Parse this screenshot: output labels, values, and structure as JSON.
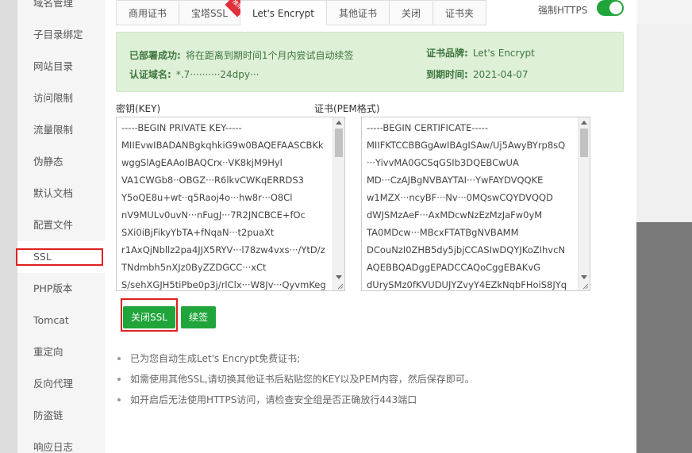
{
  "sidebar": {
    "items": [
      {
        "label": "域名管理"
      },
      {
        "label": "子目录绑定"
      },
      {
        "label": "网站目录"
      },
      {
        "label": "访问限制"
      },
      {
        "label": "流量限制"
      },
      {
        "label": "伪静态"
      },
      {
        "label": "默认文档"
      },
      {
        "label": "配置文件"
      },
      {
        "label": "SSL"
      },
      {
        "label": "PHP版本"
      },
      {
        "label": "Tomcat"
      },
      {
        "label": "重定向"
      },
      {
        "label": "反向代理"
      },
      {
        "label": "防盗链"
      },
      {
        "label": "响应日志"
      }
    ]
  },
  "tabs": [
    {
      "label": "商用证书"
    },
    {
      "label": "宝塔SSL"
    },
    {
      "label": "Let's Encrypt"
    },
    {
      "label": "其他证书"
    },
    {
      "label": "关闭"
    },
    {
      "label": "证书夹"
    }
  ],
  "tab_badge": "推荐",
  "force_https": {
    "label": "强制HTTPS",
    "enabled": true
  },
  "info": {
    "deploy_label": "已部署成功:",
    "deploy_value": "将在距离到期时间1个月内尝试自动续签",
    "domain_label": "认证域名:",
    "domain_value": "*.7··········24dpy···",
    "brand_label": "证书品牌:",
    "brand_value": "Let's Encrypt",
    "expire_label": "到期时间:",
    "expire_value": "2021-04-07"
  },
  "key": {
    "label": "密钥(KEY)",
    "lines": [
      "-----BEGIN PRIVATE KEY-----",
      "MIIEvwIBADANBgkqhkiG9w0BAQEFAASCBKk",
      "wggSlAgEAAoIBAQCrx··VK8kjM9Hyl",
      "VA1CWGb8··OBGZ···R6lkvCWKqERRDS3",
      "Y5oQE8u+wt··q5Raoj4o···hw8r···O8Cl",
      "nV9MULv0uvN···nFugJ···7R2JNCBCE+fOc",
      "SXi0iBjFikyYbTA+fNqaN···t2puaXt",
      "r1AxQjNbllz2pa4JJX5RYV···l78zw4vxs···/YtD/z",
      "TNdmbh5nXJz0ByZZDGCC···xCt",
      "S/sehXGJH5tiPbe0p3j/rlClx···W8Jv···QyvmKeg"
    ]
  },
  "cert": {
    "label": "证书(PEM格式)",
    "lines": [
      "-----BEGIN CERTIFICATE-----",
      "MIIFKTCCBBGgAwIBAgISAw/Uj5AwyBYrp8sQ",
      "···YivvMA0GCSqGSIb3DQEBCwUA",
      "MD···CzAJBgNVBAYTAI···YwFAYDVQQKE",
      "w1MZX···ncyBF···Nv···0MQswCQYDVQQD",
      "dWJSMzAeF···AxMDcwNzEzMzJaFw0yM",
      "TA0MDcw···MBcxFTATBgNVBAMM",
      "DCouNzI0ZHB5dy5jbjCCASIwDQYJKoZIhvcN",
      "AQEBBQADggEPADCCAQoCggEBAKvG",
      "dUrySMz0fKVUDUJYZvyY4EZkNqbFHoiS8JYq"
    ]
  },
  "buttons": {
    "close_ssl": "关闭SSL",
    "renew": "续签"
  },
  "notes": [
    "已为您自动生成Let's Encrypt免费证书;",
    "如需使用其他SSL,请切换其他证书后粘贴您的KEY以及PEM内容，然后保存即可。",
    "如开启后无法使用HTTPS访问，请检查安全组是否正确放行443端口"
  ],
  "colors": {
    "accent": "#20a53a",
    "info_bg": "#dff0d8",
    "info_text": "#3c763d",
    "highlight": "#e02020"
  }
}
